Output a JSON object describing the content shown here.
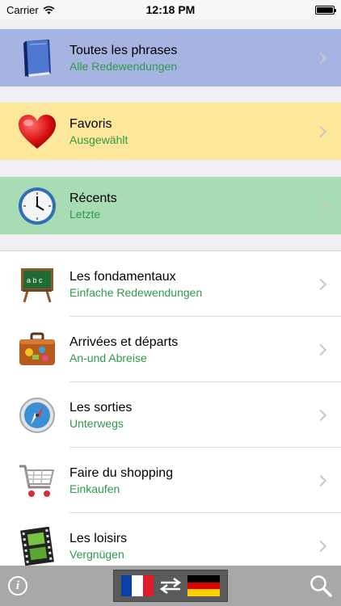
{
  "status_bar": {
    "carrier": "Carrier",
    "time": "12:18 PM",
    "battery_level": 1.0
  },
  "special_items": [
    {
      "title": "Toutes les phrases",
      "subtitle": "Alle Redewendungen",
      "icon": "book-icon",
      "color": "#a6b4e1"
    },
    {
      "title": "Favoris",
      "subtitle": "Ausgewählt",
      "icon": "heart-icon",
      "color": "#fde79a"
    },
    {
      "title": "Récents",
      "subtitle": "Letzte",
      "icon": "clock-icon",
      "color": "#a8dcb5"
    }
  ],
  "categories": [
    {
      "title": "Les fondamentaux",
      "subtitle": "Einfache Redewendungen",
      "icon": "blackboard-icon"
    },
    {
      "title": "Arrivées et départs",
      "subtitle": "An-und Abreise",
      "icon": "suitcase-icon"
    },
    {
      "title": "Les sorties",
      "subtitle": "Unterwegs",
      "icon": "compass-icon"
    },
    {
      "title": "Faire du shopping",
      "subtitle": "Einkaufen",
      "icon": "shopping-cart-icon"
    },
    {
      "title": "Les loisirs",
      "subtitle": "Vergnügen",
      "icon": "film-strip-icon"
    }
  ],
  "toolbar": {
    "info_icon": "info-icon",
    "source_flag": "france-flag-icon",
    "swap_icon": "swap-arrows-icon",
    "target_flag": "germany-flag-icon",
    "search_icon": "search-icon"
  },
  "colors": {
    "subtitle_green": "#2e9a4a",
    "toolbar_gray": "#a8a8a8"
  }
}
